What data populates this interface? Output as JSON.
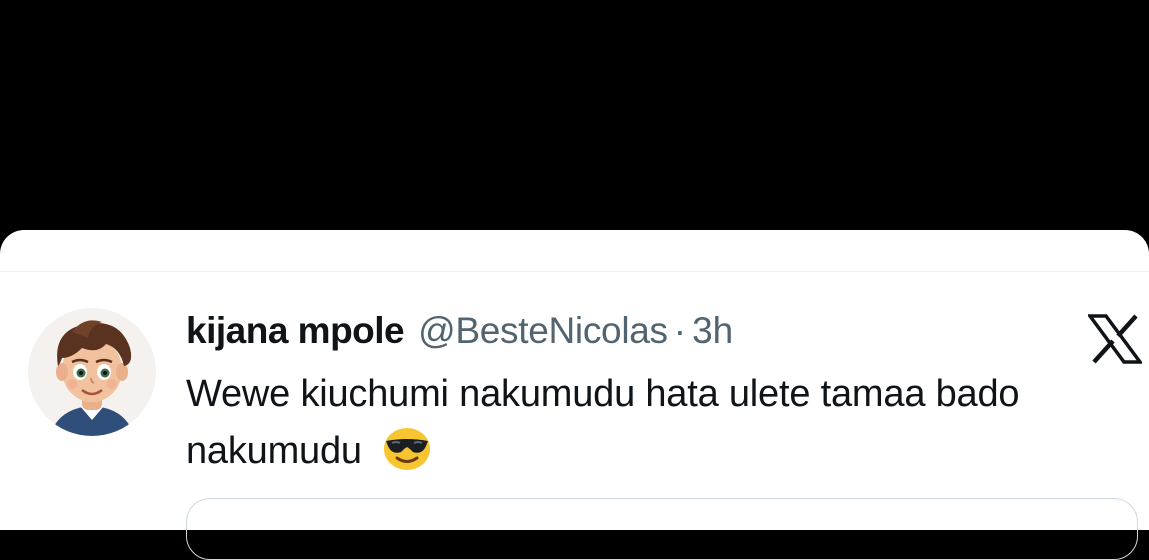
{
  "tweet": {
    "display_name": "kijana mpole",
    "handle": "@BesteNicolas",
    "separator": "·",
    "time": "3h",
    "text": "Wewe kiuchumi nakumudu hata ulete tamaa bado nakumudu",
    "emoji_icon": "smiling-face-with-sunglasses-icon",
    "platform_icon": "x-logo-icon"
  },
  "colors": {
    "name": "#0f1419",
    "secondary": "#536471",
    "divider": "#eff3f4",
    "card_background": "#ffffff",
    "page_background": "#000000"
  }
}
